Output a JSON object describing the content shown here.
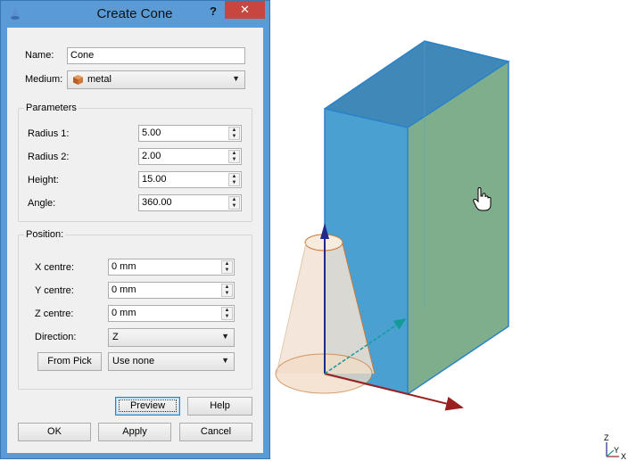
{
  "window": {
    "title": "Create Cone",
    "help": "?",
    "close": "✕"
  },
  "form": {
    "name_label": "Name:",
    "name_value": "Cone",
    "medium_label": "Medium:",
    "medium_value": "metal"
  },
  "parameters": {
    "title": "Parameters",
    "rows": [
      {
        "label": "Radius 1:",
        "value": "5.00"
      },
      {
        "label": "Radius 2:",
        "value": "2.00"
      },
      {
        "label": "Height:",
        "value": "15.00"
      },
      {
        "label": "Angle:",
        "value": "360.00"
      }
    ]
  },
  "position": {
    "title": "Position:",
    "rows": [
      {
        "label": "X centre:",
        "value": "0 mm"
      },
      {
        "label": "Y centre:",
        "value": "0 mm"
      },
      {
        "label": "Z centre:",
        "value": "0 mm"
      }
    ],
    "direction_label": "Direction:",
    "direction_value": "Z",
    "from_pick": "From Pick",
    "pick_value": "Use none"
  },
  "buttons": {
    "preview": "Preview",
    "help": "Help",
    "ok": "OK",
    "apply": "Apply",
    "cancel": "Cancel"
  },
  "axes": {
    "z": "Z",
    "y": "Y",
    "x": "X"
  },
  "colors": {
    "window_frame": "#5b9bd5",
    "close_red": "#c7463f",
    "box_blue": "#4aa0d0",
    "box_green": "#7fae8c",
    "cone_fill": "#f2e2d3",
    "arrow_red": "#9a1f1f",
    "arrow_blue": "#1f2a8a",
    "arrow_teal": "#159a9a"
  }
}
